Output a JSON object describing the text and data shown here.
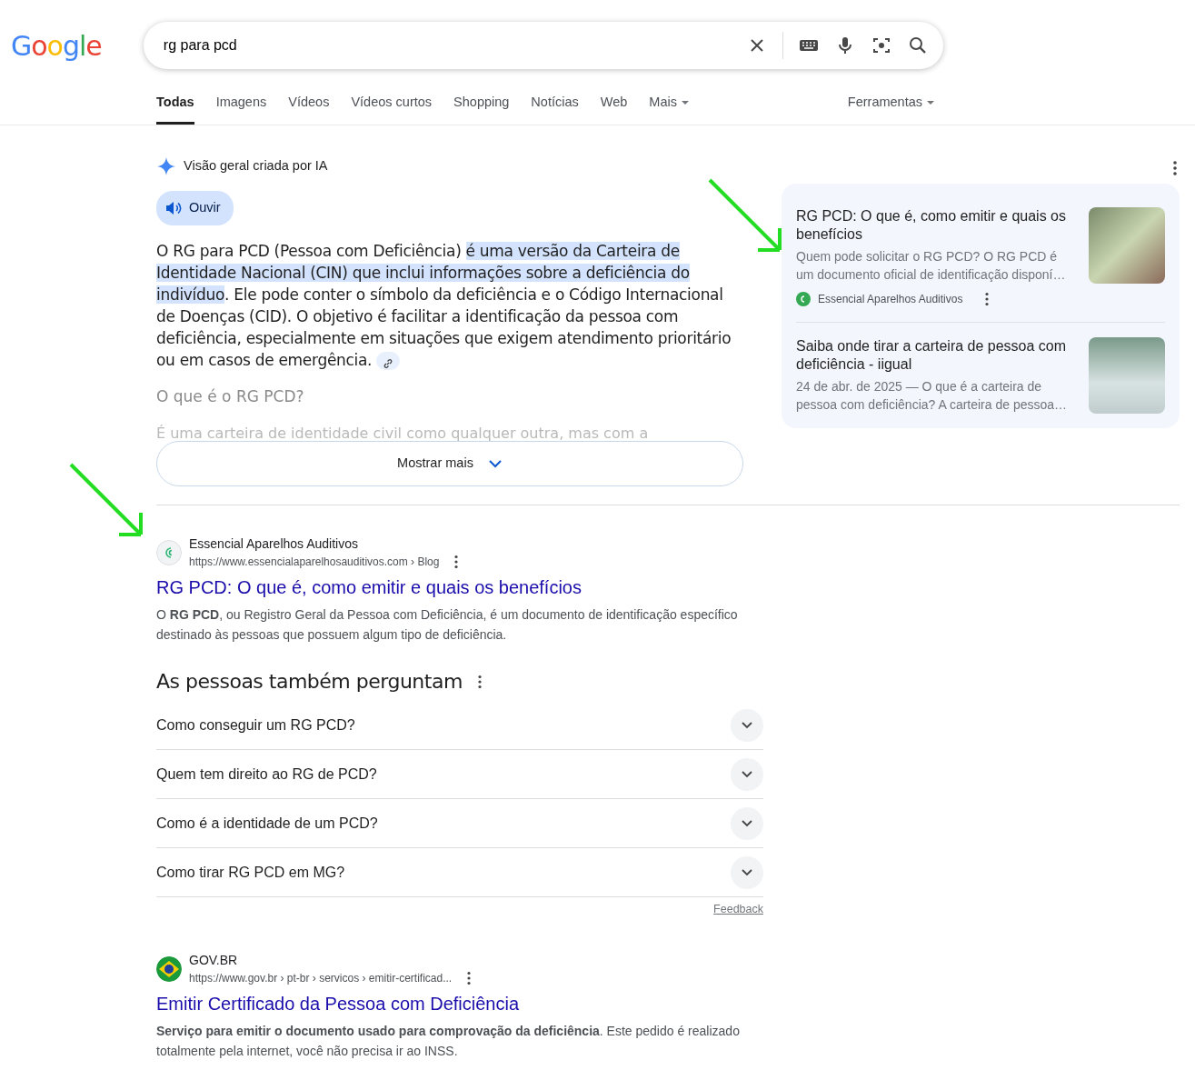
{
  "logo": "Google",
  "search": {
    "value": "rg para pcd"
  },
  "tabs": [
    {
      "label": "Todas",
      "selected": true
    },
    {
      "label": "Imagens",
      "selected": false
    },
    {
      "label": "Vídeos",
      "selected": false
    },
    {
      "label": "Vídeos curtos",
      "selected": false
    },
    {
      "label": "Shopping",
      "selected": false
    },
    {
      "label": "Notícias",
      "selected": false
    },
    {
      "label": "Web",
      "selected": false
    },
    {
      "label": "Mais",
      "selected": false,
      "kind": "menu"
    }
  ],
  "tools": "Ferramentas",
  "ai_overview": {
    "title": "Visão geral criada por IA",
    "listen": "Ouvir",
    "paragraph": [
      {
        "text": "O RG para PCD (Pessoa com Deficiência) ",
        "highlighted": false
      },
      {
        "text": "é uma versão da Carteira de Identidade Nacional (CIN) que inclui informações sobre a deficiência do indivíduo",
        "highlighted": true
      },
      {
        "text": ". Ele pode conter o símbolo da deficiência e o Código Internacional de Doenças (CID). O objetivo é facilitar a identificação da pessoa com deficiência, especialmente em situações que exigem atendimento prioritário ou em casos de emergência.",
        "highlighted": false
      }
    ],
    "subheading": "O que é o RG PCD?",
    "faded_text": "É uma carteira de identidade civil como qualquer outra, mas com a",
    "show_more": "Mostrar mais",
    "sources": [
      {
        "title": "RG PCD: O que é, como emitir e quais os benefícios",
        "snippet": "Quem pode solicitar o RG PCD? O RG PCD é um documento oficial de identificação disponí…",
        "site": "Essencial Aparelhos Auditivos"
      },
      {
        "title": "Saiba onde tirar a carteira de pessoa com deficiência - iigual",
        "snippet": "24 de abr. de 2025 — O que é a carteira de pessoa com deficiência? A carteira de pessoa…"
      }
    ]
  },
  "results": [
    {
      "site": "Essencial Aparelhos Auditivos",
      "url": "https://www.essencialaparelhosauditivos.com › Blog",
      "title": "RG PCD: O que é, como emitir e quais os benefícios",
      "snippet": "O **RG PCD**, ou Registro Geral da Pessoa com Deficiência, é um documento de identificação específico destinado às pessoas que possuem algum tipo de deficiência."
    }
  ],
  "people_also_ask": {
    "title": "As pessoas também perguntam",
    "questions": [
      {
        "text": "Como conseguir um RG PCD?",
        "expanded": false
      },
      {
        "text": "Quem tem direito ao RG de PCD?",
        "expanded": false
      },
      {
        "text": "Como é a identidade de um PCD?",
        "expanded": false
      },
      {
        "text": "Como tirar RG PCD em MG?",
        "expanded": false
      }
    ],
    "feedback": "Feedback"
  },
  "results_2": [
    {
      "site": "GOV.BR",
      "url": "https://www.gov.br › pt-br › servicos › emitir-certificad...",
      "title": "Emitir Certificado da Pessoa com Deficiência",
      "snippet": "**Serviço para emitir o documento usado para comprovação da deficiência**. Este pedido é realizado totalmente pela internet, você não precisa ir ao INSS."
    }
  ]
}
